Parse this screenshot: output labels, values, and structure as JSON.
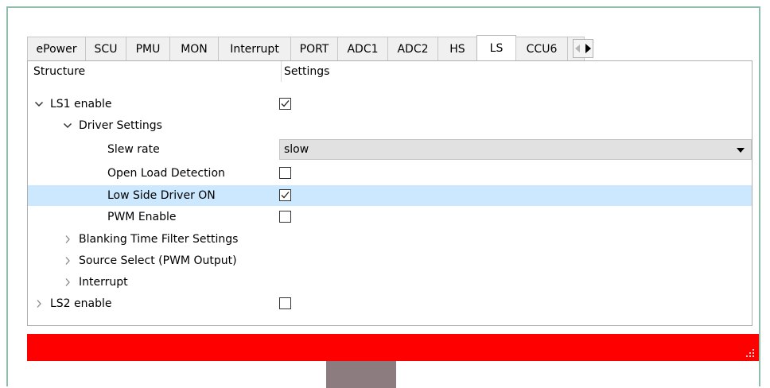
{
  "tabs": [
    {
      "label": "ePower",
      "active": false
    },
    {
      "label": "SCU",
      "active": false
    },
    {
      "label": "PMU",
      "active": false
    },
    {
      "label": "MON",
      "active": false
    },
    {
      "label": "Interrupt",
      "active": false
    },
    {
      "label": "PORT",
      "active": false
    },
    {
      "label": "ADC1",
      "active": false
    },
    {
      "label": "ADC2",
      "active": false
    },
    {
      "label": "HS",
      "active": false
    },
    {
      "label": "LS",
      "active": true
    },
    {
      "label": "CCU6",
      "active": false
    }
  ],
  "tree": {
    "header": {
      "structure": "Structure",
      "settings": "Settings"
    },
    "rows": [
      {
        "label": "LS1 enable",
        "expander": "expanded",
        "control": "checkbox",
        "checked": true
      },
      {
        "label": "Driver Settings",
        "expander": "expanded",
        "control": "none"
      },
      {
        "label": "Slew rate",
        "expander": "none",
        "control": "combo",
        "value": "slow"
      },
      {
        "label": "Open Load Detection",
        "expander": "none",
        "control": "checkbox",
        "checked": false
      },
      {
        "label": "Low Side Driver ON",
        "expander": "none",
        "control": "checkbox",
        "checked": true,
        "selected": true
      },
      {
        "label": "PWM Enable",
        "expander": "none",
        "control": "checkbox",
        "checked": false
      },
      {
        "label": "Blanking Time Filter Settings",
        "expander": "collapsed",
        "control": "none"
      },
      {
        "label": "Source Select (PWM Output)",
        "expander": "collapsed",
        "control": "none"
      },
      {
        "label": "Interrupt",
        "expander": "collapsed",
        "control": "none"
      },
      {
        "label": "LS2 enable",
        "expander": "collapsed",
        "control": "checkbox",
        "checked": false
      }
    ]
  },
  "colors": {
    "status_bar": "#ff0000",
    "selection": "#cce8ff",
    "frame": "#8fbfa8",
    "handle": "#8c7b7f"
  }
}
